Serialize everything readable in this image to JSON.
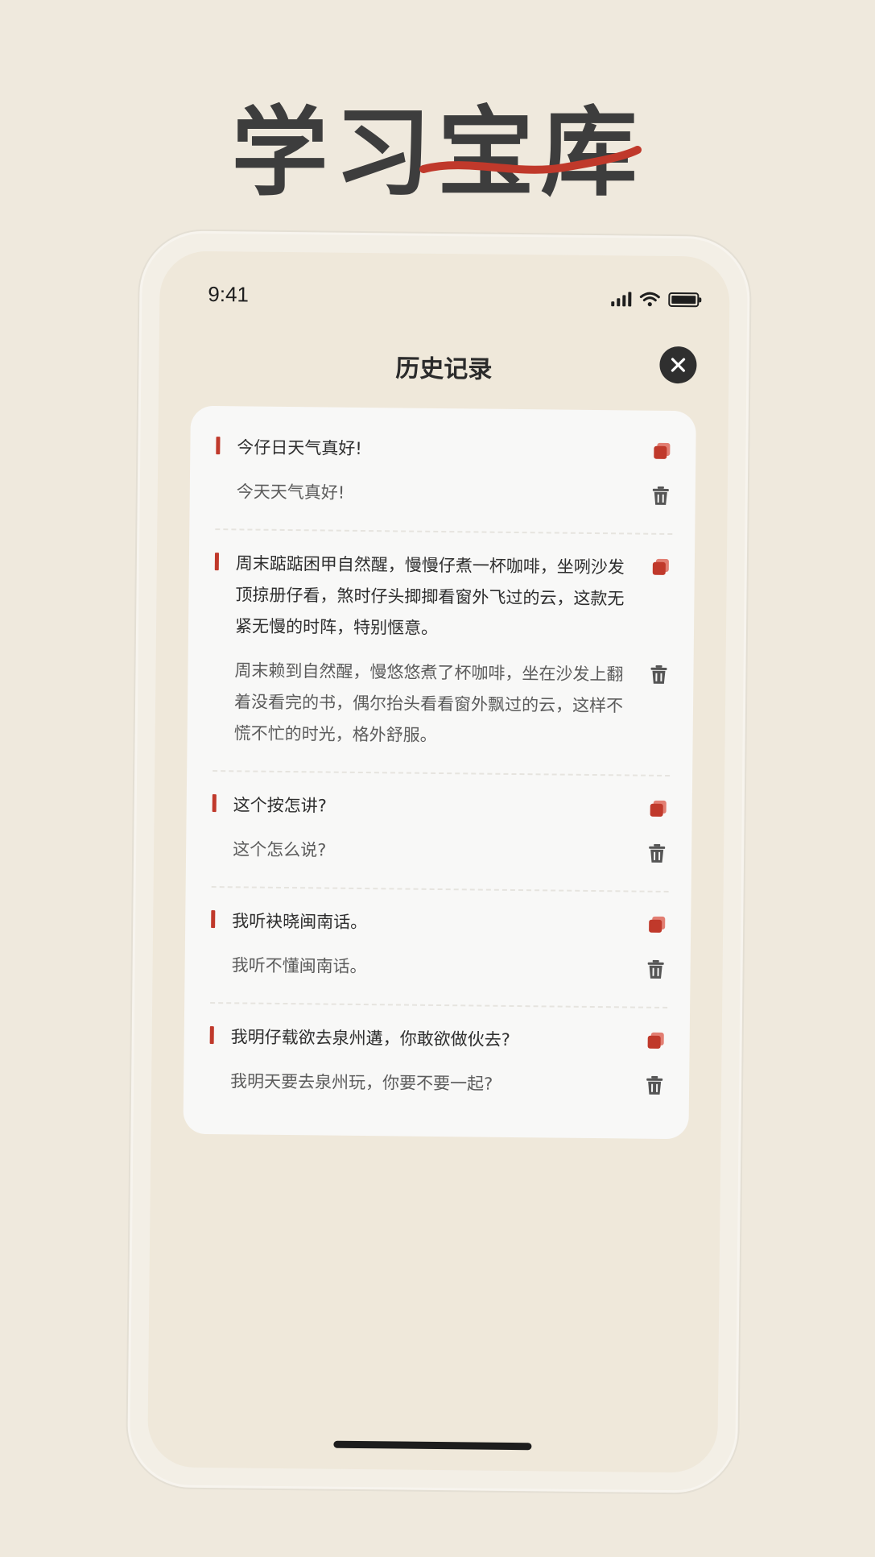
{
  "promo": {
    "title": "学习宝库",
    "accent_color": "#c0392b"
  },
  "status_bar": {
    "time": "9:41"
  },
  "header": {
    "title": "历史记录",
    "close_icon": "close-icon"
  },
  "history": [
    {
      "original": "今仔日天气真好!",
      "translation": "今天天气真好!"
    },
    {
      "original": "周末踮踮困甲自然醒，慢慢仔煮一杯咖啡，坐咧沙发顶掠册仔看，煞时仔头揤揤看窗外飞过的云，这款无紧无慢的时阵，特别惬意。",
      "translation": "周末赖到自然醒，慢悠悠煮了杯咖啡，坐在沙发上翻着没看完的书，偶尔抬头看看窗外飘过的云，这样不慌不忙的时光，格外舒服。"
    },
    {
      "original": "这个按怎讲?",
      "translation": "这个怎么说?"
    },
    {
      "original": "我听袂晓闽南话。",
      "translation": "我听不懂闽南话。"
    },
    {
      "original": "我明仔载欲去泉州遘，你敢欲做伙去?",
      "translation": "我明天要去泉州玩，你要不要一起?"
    }
  ],
  "icons": {
    "copy": "copy-icon",
    "delete": "trash-icon"
  },
  "colors": {
    "background": "#efe9dd",
    "card": "#f8f8f7",
    "marker": "#c0392b"
  }
}
